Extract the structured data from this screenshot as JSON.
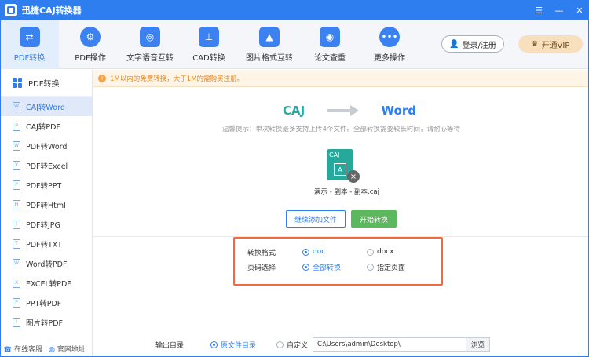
{
  "app": {
    "title": "迅捷CAJ转换器"
  },
  "window_controls": {
    "menu": "☰",
    "minimize": "—",
    "close": "✕"
  },
  "toolbar": {
    "tools": [
      {
        "label": "PDF转换",
        "icon": "⇄"
      },
      {
        "label": "PDF操作",
        "icon": "⚙"
      },
      {
        "label": "文字语音互转",
        "icon": "◎"
      },
      {
        "label": "CAD转换",
        "icon": "⊥"
      },
      {
        "label": "图片格式互转",
        "icon": "▲"
      },
      {
        "label": "论文查重",
        "icon": "◉"
      },
      {
        "label": "更多操作",
        "icon": "•••"
      }
    ],
    "login_label": "登录/注册",
    "vip_label": "开通VIP"
  },
  "sidebar": {
    "header": "PDF转换",
    "items": [
      {
        "label": "CAJ转Word"
      },
      {
        "label": "CAJ转PDF"
      },
      {
        "label": "PDF转Word"
      },
      {
        "label": "PDF转Excel"
      },
      {
        "label": "PDF转PPT"
      },
      {
        "label": "PDF转Html"
      },
      {
        "label": "PDF转JPG"
      },
      {
        "label": "PDF转TXT"
      },
      {
        "label": "Word转PDF"
      },
      {
        "label": "EXCEL转PDF"
      },
      {
        "label": "PPT转PDF"
      },
      {
        "label": "图片转PDF"
      }
    ],
    "footer_service": "在线客服",
    "footer_site": "官网地址"
  },
  "notice": {
    "text": "1M以内的免费转换，大于1M的需购买注册。"
  },
  "conversion": {
    "from": "CAJ",
    "to": "Word"
  },
  "tip": "温馨提示：单次转换最多支持上传4个文件。全部转换需要较长时间，请耐心等待",
  "file": {
    "name": "演示 - 副本 - 副本.caj",
    "type": "CAJ",
    "inner": "A"
  },
  "actions": {
    "add_files": "继续添加文件",
    "start": "开始转换"
  },
  "options": {
    "format_label": "转换格式",
    "format_options": [
      "doc",
      "docx"
    ],
    "page_label": "页码选择",
    "page_options": [
      "全部转换",
      "指定页面"
    ]
  },
  "output": {
    "label": "输出目录",
    "option_original": "原文件目录",
    "option_custom": "自定义",
    "path": "C:\\Users\\admin\\Desktop\\",
    "browse": "浏览"
  }
}
